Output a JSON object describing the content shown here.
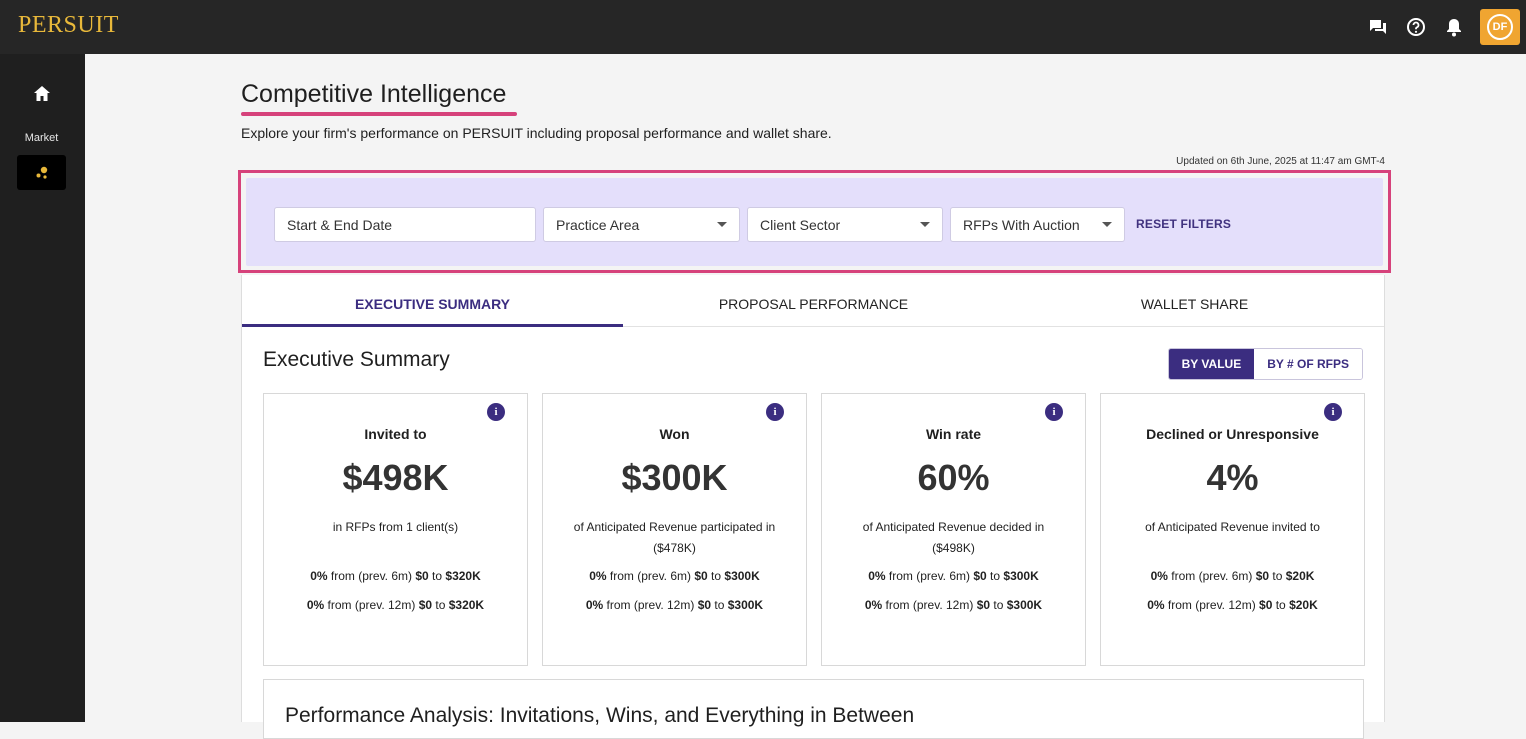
{
  "app": {
    "logo": "PERSUIT",
    "avatar_initials": "DF"
  },
  "sidebar": {
    "market_label": "Market"
  },
  "page": {
    "title": "Competitive Intelligence",
    "subtitle": "Explore your firm's performance on PERSUIT including proposal performance and wallet share.",
    "updated": "Updated on 6th June, 2025 at 11:47 am GMT-4"
  },
  "filters": {
    "date": "Start & End Date",
    "practice_area": "Practice Area",
    "client_sector": "Client Sector",
    "auction": "RFPs With Auction",
    "reset": "RESET FILTERS"
  },
  "tabs": [
    "EXECUTIVE SUMMARY",
    "PROPOSAL PERFORMANCE",
    "WALLET SHARE"
  ],
  "summary": {
    "title": "Executive Summary",
    "toggle_value": "BY VALUE",
    "toggle_count": "BY # OF RFPS",
    "cards": [
      {
        "title": "Invited to",
        "value": "$498K",
        "desc": "in RFPs from 1 client(s)",
        "l1_pct": "0%",
        "l1_from": " from (prev. 6m) ",
        "l1_a": "$0",
        "l1_to": " to ",
        "l1_b": "$320K",
        "l2_pct": "0%",
        "l2_from": " from (prev. 12m) ",
        "l2_a": "$0",
        "l2_to": " to ",
        "l2_b": "$320K"
      },
      {
        "title": "Won",
        "value": "$300K",
        "desc": "of Anticipated Revenue participated in ($478K)",
        "l1_pct": "0%",
        "l1_from": " from (prev. 6m) ",
        "l1_a": "$0",
        "l1_to": " to ",
        "l1_b": "$300K",
        "l2_pct": "0%",
        "l2_from": " from (prev. 12m) ",
        "l2_a": "$0",
        "l2_to": " to ",
        "l2_b": "$300K"
      },
      {
        "title": "Win rate",
        "value": "60%",
        "desc": "of Anticipated Revenue decided in ($498K)",
        "l1_pct": "0%",
        "l1_from": " from (prev. 6m) ",
        "l1_a": "$0",
        "l1_to": " to ",
        "l1_b": "$300K",
        "l2_pct": "0%",
        "l2_from": " from (prev. 12m) ",
        "l2_a": "$0",
        "l2_to": " to ",
        "l2_b": "$300K"
      },
      {
        "title": "Declined or Unresponsive",
        "value": "4%",
        "desc": "of Anticipated Revenue invited to",
        "l1_pct": "0%",
        "l1_from": " from (prev. 6m) ",
        "l1_a": "$0",
        "l1_to": " to ",
        "l1_b": "$20K",
        "l2_pct": "0%",
        "l2_from": " from (prev. 12m) ",
        "l2_a": "$0",
        "l2_to": " to ",
        "l2_b": "$20K"
      }
    ],
    "info_glyph": "i"
  },
  "performance": {
    "title": "Performance Analysis: Invitations, Wins, and Everything in Between"
  },
  "colors": {
    "accent": "#3b2d80",
    "highlight": "#d6427b",
    "filter_bg": "#e4dffb",
    "brand_gold": "#e8b83a",
    "avatar": "#f0a531"
  }
}
